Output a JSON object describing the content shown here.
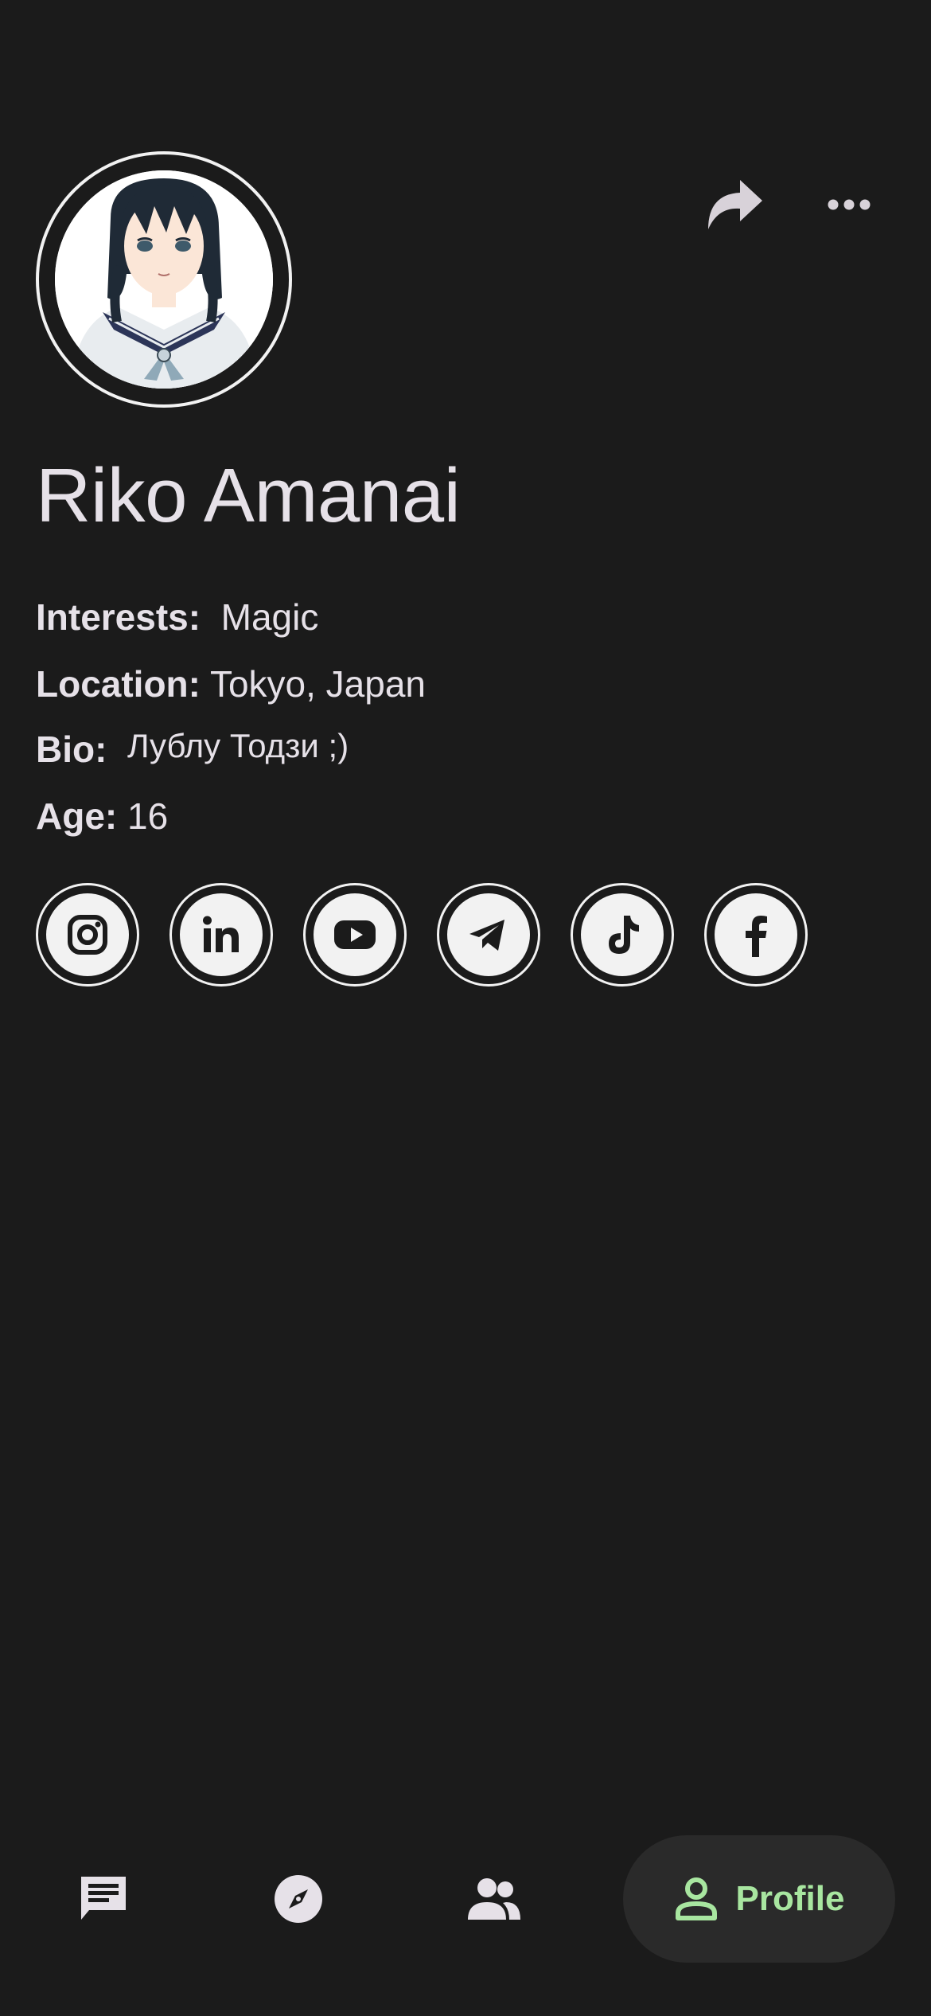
{
  "profile": {
    "name": "Riko Amanai",
    "avatar_icon": "anime-girl-avatar",
    "interests_label": "Interests:",
    "interests_value": "Magic",
    "location_label": "Location:",
    "location_value": "Tokyo, Japan",
    "bio_label": "Bio:",
    "bio_value": "Лублу Тодзи ;)",
    "age_label": "Age:",
    "age_value": "16"
  },
  "actions": {
    "share_icon": "share-icon",
    "more_icon": "more-horizontal-icon"
  },
  "socials": [
    {
      "name": "instagram",
      "icon": "instagram-icon"
    },
    {
      "name": "linkedin",
      "icon": "linkedin-icon"
    },
    {
      "name": "youtube",
      "icon": "youtube-icon"
    },
    {
      "name": "telegram",
      "icon": "telegram-icon"
    },
    {
      "name": "tiktok",
      "icon": "tiktok-icon"
    },
    {
      "name": "facebook",
      "icon": "facebook-icon"
    }
  ],
  "nav": {
    "items": [
      {
        "id": "chats",
        "icon": "chat-icon"
      },
      {
        "id": "explore",
        "icon": "compass-icon"
      },
      {
        "id": "friends",
        "icon": "people-icon"
      },
      {
        "id": "profile",
        "icon": "person-icon",
        "label": "Profile",
        "active": true
      }
    ]
  },
  "colors": {
    "background": "#1b1b1b",
    "text": "#e6e1e8",
    "accent": "#a8e6a0",
    "nav_active_bg": "#2a2a2a",
    "icon_muted": "#d8d2d9"
  }
}
